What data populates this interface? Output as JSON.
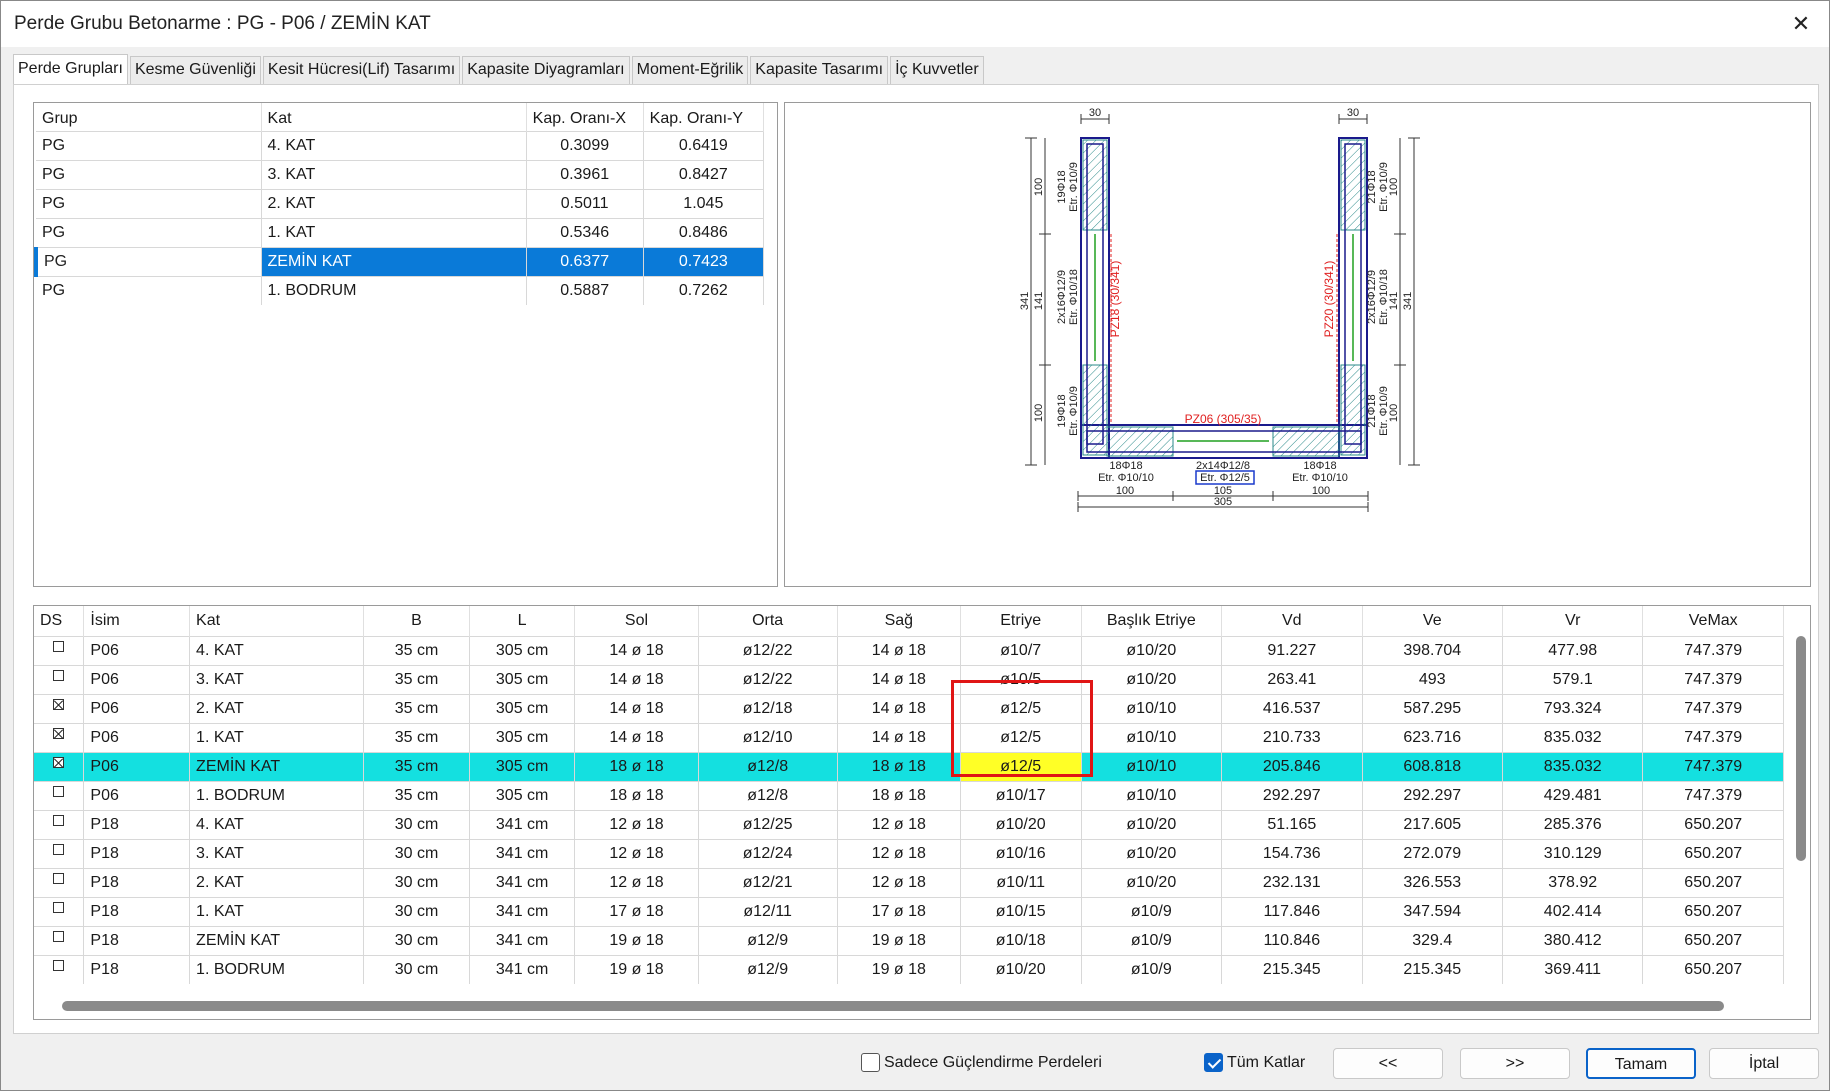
{
  "window": {
    "title": "Perde Grubu Betonarme  :  PG - P06 / ZEMİN KAT",
    "close_glyph": "✕"
  },
  "tabs": [
    "Perde Grupları",
    "Kesme Güvenliği",
    "Kesit Hücresi(Lif) Tasarımı",
    "Kapasite Diyagramları",
    "Moment-Eğrilik",
    "Kapasite Tasarımı",
    "İç Kuvvetler"
  ],
  "group_table": {
    "headers": [
      "Grup",
      "Kat",
      "Kap. Oranı-X",
      "Kap. Oranı-Y"
    ],
    "rows": [
      [
        "PG",
        "4. KAT",
        "0.3099",
        "0.6419"
      ],
      [
        "PG",
        "3. KAT",
        "0.3961",
        "0.8427"
      ],
      [
        "PG",
        "2. KAT",
        "0.5011",
        "1.045"
      ],
      [
        "PG",
        "1. KAT",
        "0.5346",
        "0.8486"
      ],
      [
        "PG",
        "ZEMİN KAT",
        "0.6377",
        "0.7423"
      ],
      [
        "PG",
        "1. BODRUM",
        "0.5887",
        "0.7262"
      ]
    ],
    "selected_row": 4,
    "selection_color": "#0a7ad8"
  },
  "drawing": {
    "dim_top_left": "30",
    "dim_top_right": "30",
    "dim_left_100_top": "100",
    "dim_left_341": "341",
    "dim_left_141": "141",
    "dim_left_100_bot": "100",
    "dim_right_100_top": "100",
    "dim_right_341": "341",
    "dim_right_141": "141",
    "dim_right_100_bot": "100",
    "left_top_bars": "19Φ18",
    "left_top_stirrup": "Etr. Φ10/9",
    "left_mid_bars": "2x16Φ12/9",
    "left_mid_stirrup": "Etr. Φ10/18",
    "left_bot_bars": "19Φ18",
    "left_bot_stirrup": "Etr. Φ10/9",
    "right_top_bars": "21Φ18",
    "right_top_stirrup": "Etr. Φ10/9",
    "right_mid_bars": "2x16Φ12/9",
    "right_mid_stirrup": "Etr. Φ10/18",
    "right_bot_bars": "21Φ18",
    "right_bot_stirrup": "Etr. Φ10/9",
    "pz18": "PZ18 (30/341)",
    "pz20": "PZ20 (30/341)",
    "pz06": "PZ06 (305/35)",
    "bot_left_bars": "18Φ18",
    "bot_left_stirrup": "Etr. Φ10/10",
    "bot_mid_bars": "2x14Φ12/8",
    "bot_mid_stirrup": "Etr. Φ12/5",
    "bot_right_bars": "18Φ18",
    "bot_right_stirrup": "Etr. Φ10/10",
    "dim_bot_100a": "100",
    "dim_bot_105": "105",
    "dim_bot_100b": "100",
    "dim_bot_305": "305",
    "colors": {
      "outline": "#1a1a8c",
      "hatch": "#2a8a8a",
      "label_red": "#e02020",
      "rebar_green": "#20a020"
    }
  },
  "main_table": {
    "headers": [
      "DS",
      "İsim",
      "Kat",
      "B",
      "L",
      "Sol",
      "Orta",
      "Sağ",
      "Etriye",
      "Başlık Etriye",
      "Vd",
      "Ve",
      "Vr",
      "VeMax"
    ],
    "rows": [
      {
        "ds": false,
        "cells": [
          "P06",
          "4. KAT",
          "35 cm",
          "305 cm",
          "14 ø 18",
          "ø12/22",
          "14 ø 18",
          "ø10/7",
          "ø10/20",
          "91.227",
          "398.704",
          "477.98",
          "747.379"
        ]
      },
      {
        "ds": false,
        "cells": [
          "P06",
          "3. KAT",
          "35 cm",
          "305 cm",
          "14 ø 18",
          "ø12/22",
          "14 ø 18",
          "ø10/5",
          "ø10/20",
          "263.41",
          "493",
          "579.1",
          "747.379"
        ]
      },
      {
        "ds": true,
        "cells": [
          "P06",
          "2. KAT",
          "35 cm",
          "305 cm",
          "14 ø 18",
          "ø12/18",
          "14 ø 18",
          "ø12/5",
          "ø10/10",
          "416.537",
          "587.295",
          "793.324",
          "747.379"
        ]
      },
      {
        "ds": true,
        "cells": [
          "P06",
          "1. KAT",
          "35 cm",
          "305 cm",
          "14 ø 18",
          "ø12/10",
          "14 ø 18",
          "ø12/5",
          "ø10/10",
          "210.733",
          "623.716",
          "835.032",
          "747.379"
        ]
      },
      {
        "ds": true,
        "cells": [
          "P06",
          "ZEMİN KAT",
          "35 cm",
          "305 cm",
          "18 ø 18",
          "ø12/8",
          "18 ø 18",
          "ø12/5",
          "ø10/10",
          "205.846",
          "608.818",
          "835.032",
          "747.379"
        ]
      },
      {
        "ds": false,
        "cells": [
          "P06",
          "1. BODRUM",
          "35 cm",
          "305 cm",
          "18 ø 18",
          "ø12/8",
          "18 ø 18",
          "ø10/17",
          "ø10/10",
          "292.297",
          "292.297",
          "429.481",
          "747.379"
        ]
      },
      {
        "ds": false,
        "cells": [
          "P18",
          "4. KAT",
          "30 cm",
          "341 cm",
          "12 ø 18",
          "ø12/25",
          "12 ø 18",
          "ø10/20",
          "ø10/20",
          "51.165",
          "217.605",
          "285.376",
          "650.207"
        ]
      },
      {
        "ds": false,
        "cells": [
          "P18",
          "3. KAT",
          "30 cm",
          "341 cm",
          "12 ø 18",
          "ø12/24",
          "12 ø 18",
          "ø10/16",
          "ø10/20",
          "154.736",
          "272.079",
          "310.129",
          "650.207"
        ]
      },
      {
        "ds": false,
        "cells": [
          "P18",
          "2. KAT",
          "30 cm",
          "341 cm",
          "12 ø 18",
          "ø12/21",
          "12 ø 18",
          "ø10/11",
          "ø10/20",
          "232.131",
          "326.553",
          "378.92",
          "650.207"
        ]
      },
      {
        "ds": false,
        "cells": [
          "P18",
          "1. KAT",
          "30 cm",
          "341 cm",
          "17 ø 18",
          "ø12/11",
          "17 ø 18",
          "ø10/15",
          "ø10/9",
          "117.846",
          "347.594",
          "402.414",
          "650.207"
        ]
      },
      {
        "ds": false,
        "cells": [
          "P18",
          "ZEMİN KAT",
          "30 cm",
          "341 cm",
          "19 ø 18",
          "ø12/9",
          "19 ø 18",
          "ø10/18",
          "ø10/9",
          "110.846",
          "329.4",
          "380.412",
          "650.207"
        ]
      },
      {
        "ds": false,
        "cells": [
          "P18",
          "1. BODRUM",
          "30 cm",
          "341 cm",
          "19 ø 18",
          "ø12/9",
          "19 ø 18",
          "ø10/20",
          "ø10/9",
          "215.345",
          "215.345",
          "369.411",
          "650.207"
        ]
      }
    ],
    "highlight_row": 4,
    "highlight_color": "#14e0e0",
    "highlight_cell_color": "#ffff26",
    "annotation_color": "#e01515"
  },
  "footer": {
    "only_strengthening_label": "Sadece Güçlendirme Perdeleri",
    "only_strengthening_checked": false,
    "all_floors_label": "Tüm Katlar",
    "all_floors_checked": true,
    "prev_label": "<<",
    "next_label": ">>",
    "ok_label": "Tamam",
    "cancel_label": "İptal"
  }
}
